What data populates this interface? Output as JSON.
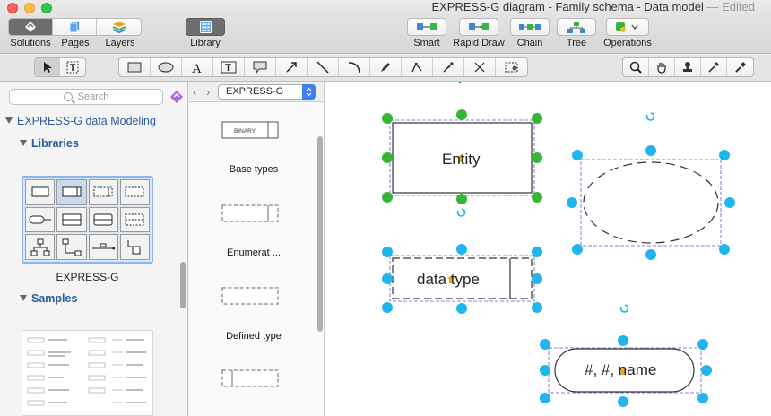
{
  "window": {
    "title": "EXPRESS-G diagram - Family schema - Data model",
    "status": "— Edited"
  },
  "toolbar": {
    "left_segments": [
      {
        "label": "Solutions",
        "icon": "solutions-icon"
      },
      {
        "label": "Pages",
        "icon": "pages-icon"
      },
      {
        "label": "Layers",
        "icon": "layers-icon"
      }
    ],
    "library_label": "Library",
    "right_buttons": [
      {
        "label": "Smart",
        "icon": "smart-connector-icon"
      },
      {
        "label": "Rapid Draw",
        "icon": "rapid-draw-icon"
      },
      {
        "label": "Chain",
        "icon": "chain-icon"
      },
      {
        "label": "Tree",
        "icon": "tree-icon"
      },
      {
        "label": "Operations",
        "icon": "operations-icon"
      }
    ]
  },
  "tools": {
    "select_group": [
      "pointer-icon",
      "text-select-icon"
    ],
    "shape_group": [
      "rectangle-icon",
      "ellipse-icon",
      "text-icon",
      "text-box-icon",
      "callout-icon",
      "arrow-icon",
      "line-icon",
      "arc-icon",
      "pen-icon",
      "bezier-icon",
      "polyline-icon",
      "connector-icon",
      "snapshot-icon"
    ],
    "view_group": [
      "zoom-icon",
      "hand-icon",
      "stamp-icon",
      "eyedropper-icon",
      "format-painter-icon"
    ]
  },
  "left_panel": {
    "search_placeholder": "Search",
    "root_label": "EXPRESS-G data Modeling",
    "libraries_label": "Libraries",
    "library_name": "EXPRESS-G",
    "samples_label": "Samples"
  },
  "library_panel": {
    "dropdown_value": "EXPRESS-G",
    "binary_label": "BINARY",
    "items": [
      {
        "caption": "Base types"
      },
      {
        "caption": "Enumerat ..."
      },
      {
        "caption": "Defined type"
      }
    ]
  },
  "canvas": {
    "shapes": [
      {
        "label": "Entity"
      },
      {
        "label": "data type"
      },
      {
        "label": "#, #, name"
      }
    ],
    "colors": {
      "handle_green": "#34b733",
      "handle_blue": "#1fb5ee",
      "selection": "#5b5bc8"
    }
  }
}
